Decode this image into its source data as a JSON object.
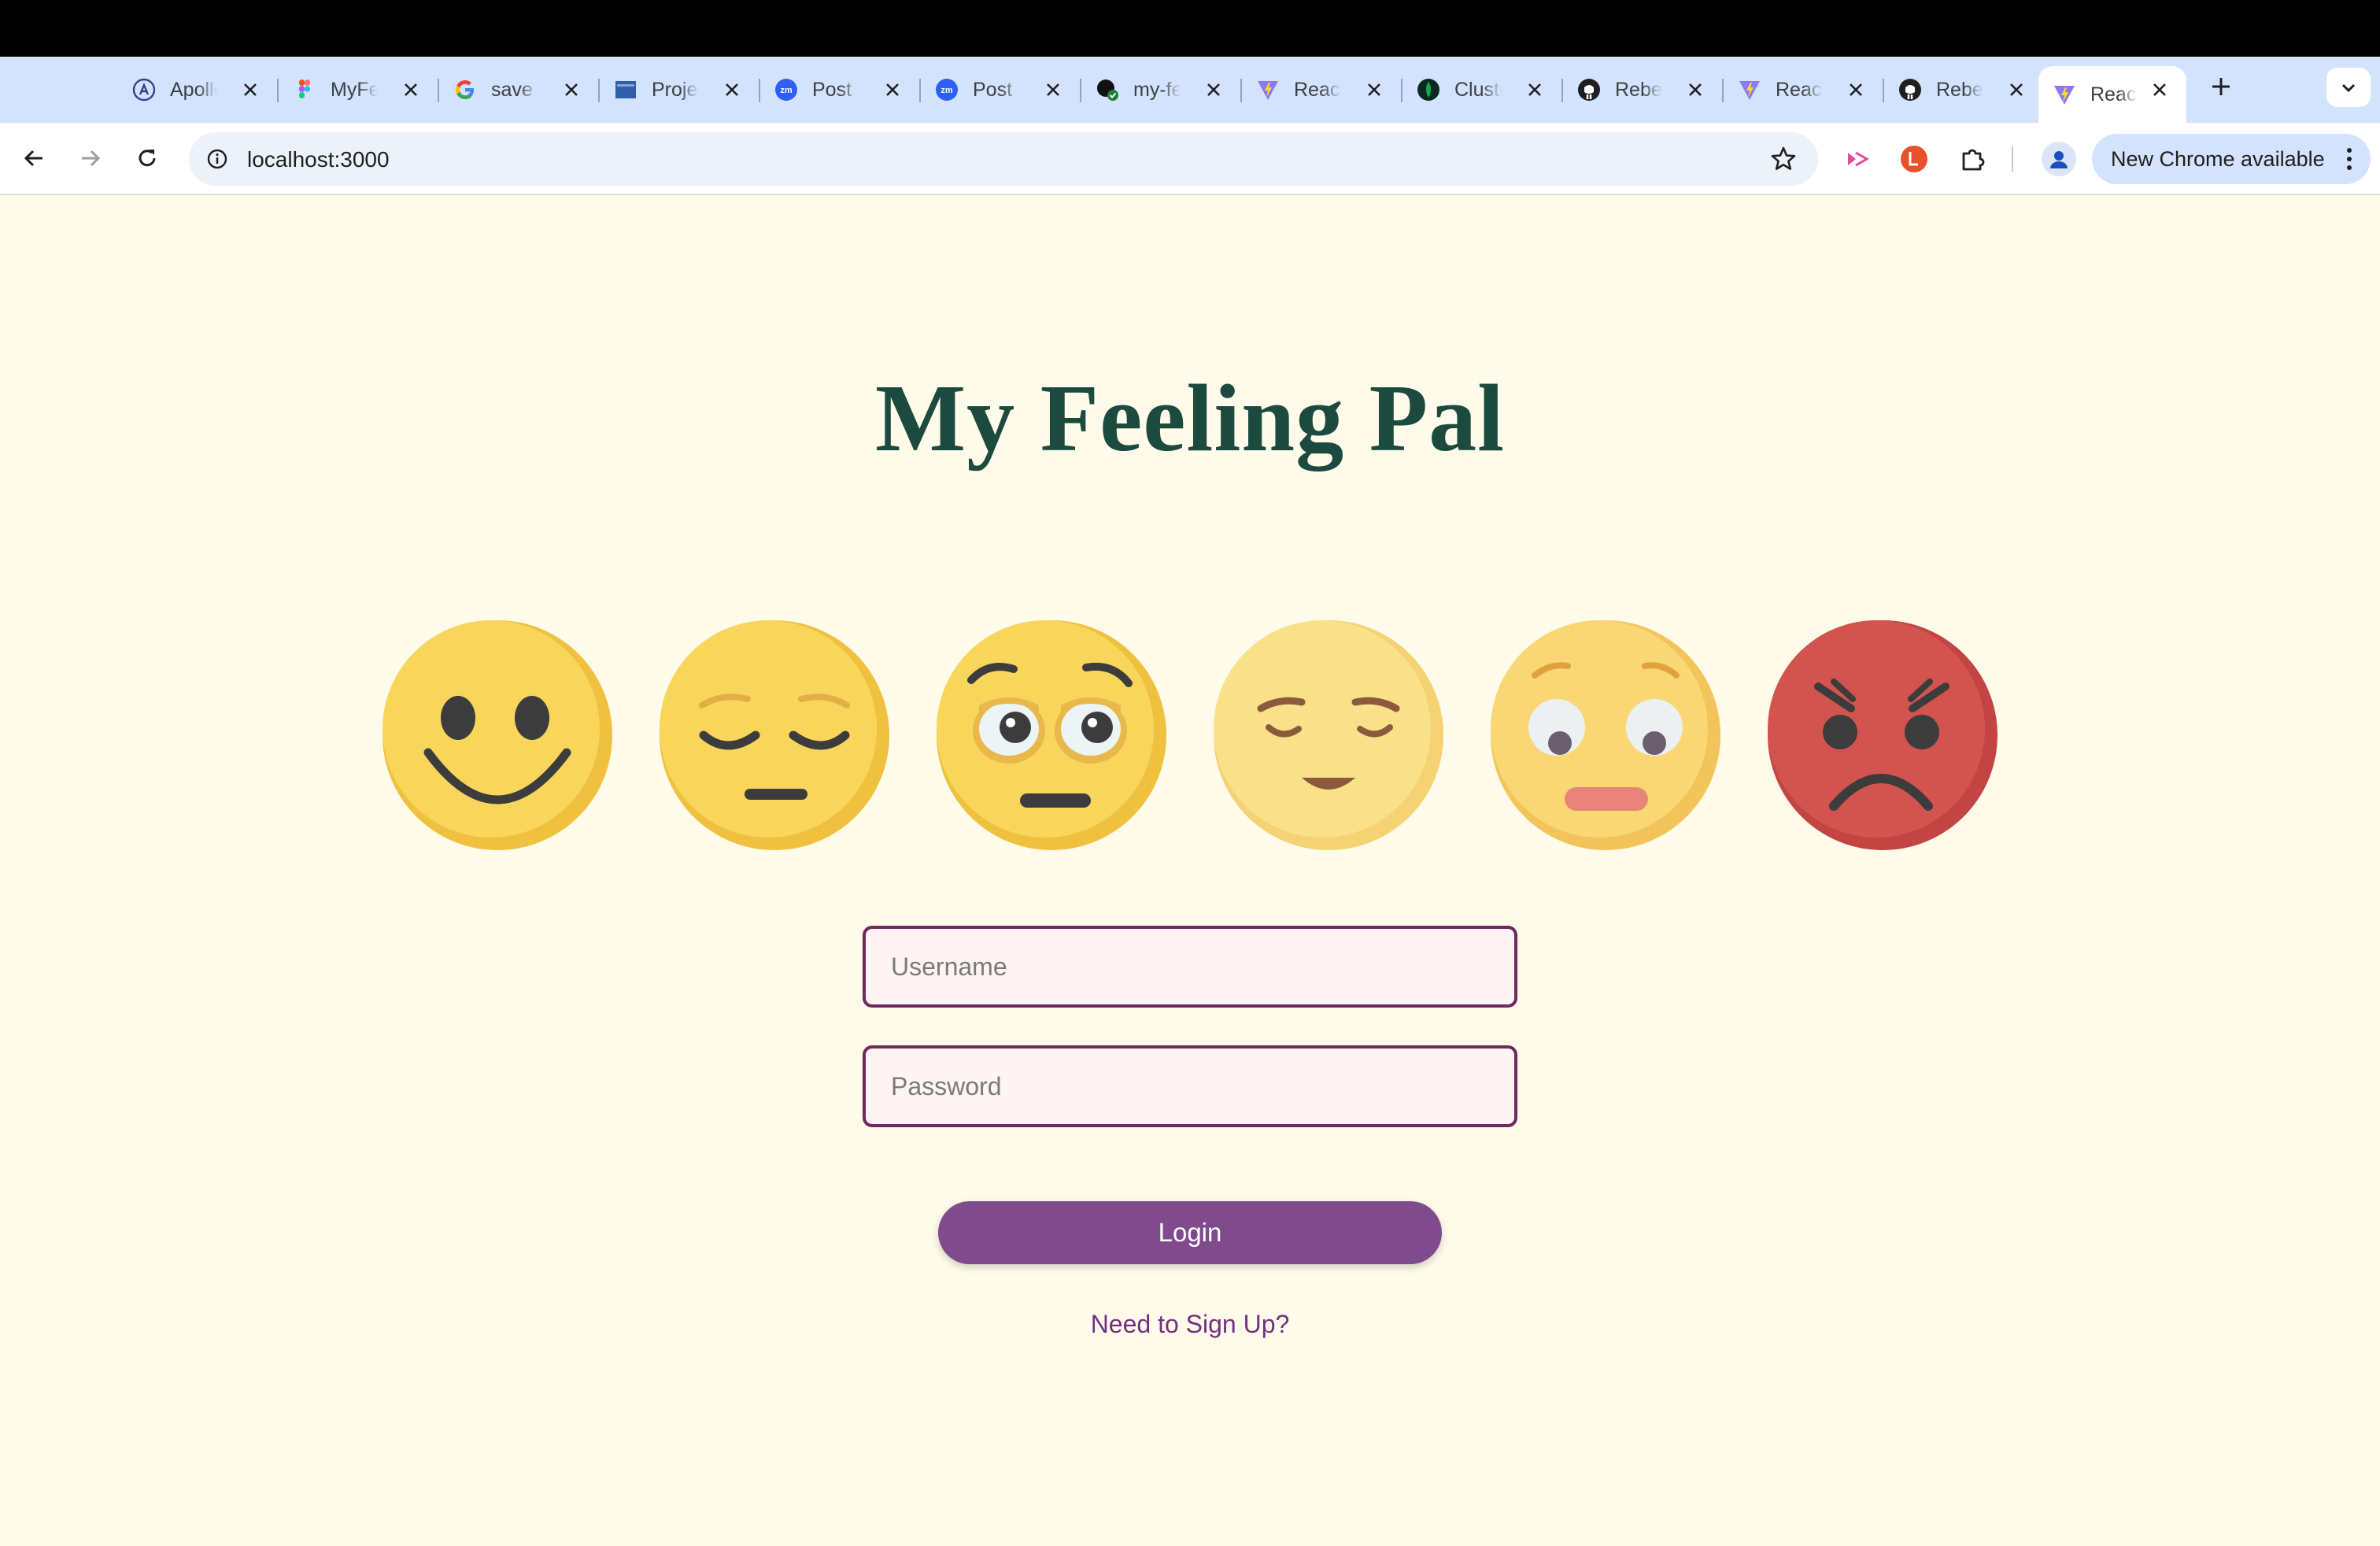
{
  "browser": {
    "tabs": [
      {
        "title": "Apollo",
        "icon": "apollo-icon"
      },
      {
        "title": "MyFeelingPal",
        "icon": "figma-icon"
      },
      {
        "title": "save",
        "icon": "google-icon"
      },
      {
        "title": "Project",
        "icon": "project-icon"
      },
      {
        "title": "Post",
        "icon": "zoom-icon"
      },
      {
        "title": "Post",
        "icon": "zoom-icon"
      },
      {
        "title": "my-feeling",
        "icon": "github-check-icon"
      },
      {
        "title": "React",
        "icon": "vite-icon"
      },
      {
        "title": "Cluster",
        "icon": "mongodb-icon"
      },
      {
        "title": "Rebecca",
        "icon": "github-icon"
      },
      {
        "title": "React",
        "icon": "vite-icon"
      },
      {
        "title": "Rebecca",
        "icon": "github-icon"
      },
      {
        "title": "React",
        "icon": "vite-icon",
        "active": true
      }
    ],
    "url": "localhost:3000",
    "update_label": "New Chrome available"
  },
  "page": {
    "title": "My Feeling Pal",
    "emojis": [
      "happy-face-icon",
      "pensive-face-icon",
      "eye-roll-face-icon",
      "relieved-face-icon",
      "worried-face-icon",
      "angry-face-icon"
    ],
    "username_placeholder": "Username",
    "password_placeholder": "Password",
    "login_label": "Login",
    "signup_link": "Need to Sign Up?"
  },
  "colors": {
    "background": "#fefbea",
    "title": "#1c4a3e",
    "button": "#7f4b8c",
    "link": "#733080",
    "field_border": "#6e2a5e"
  }
}
